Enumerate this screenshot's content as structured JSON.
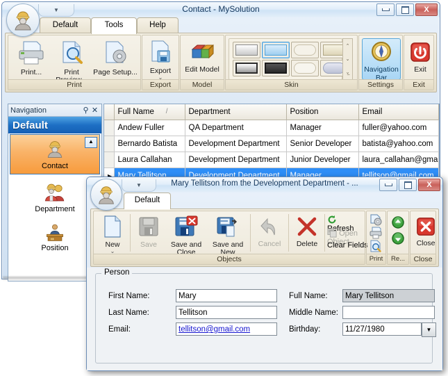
{
  "main_window": {
    "title": "Contact - MySolution",
    "app_icon": "person-hardhat-icon",
    "window_buttons": {
      "minimize": "minimize-icon",
      "maximize": "maximize-icon",
      "close": "X"
    },
    "quick_access_arrow": "▼",
    "tabs": [
      {
        "label": "Default",
        "active": false
      },
      {
        "label": "Tools",
        "active": true
      },
      {
        "label": "Help",
        "active": false
      }
    ],
    "ribbon": {
      "groups": [
        {
          "caption": "Print",
          "items": [
            {
              "label": "Print...",
              "icon": "printer-icon",
              "dropdown": false
            },
            {
              "label": "Print Preview...",
              "icon": "print-preview-icon",
              "dropdown": false
            },
            {
              "label": "Page Setup...",
              "icon": "page-setup-icon",
              "dropdown": false
            }
          ]
        },
        {
          "caption": "Export",
          "items": [
            {
              "label": "Export",
              "icon": "export-icon",
              "dropdown": true,
              "dropdown_glyph": "⌄"
            }
          ]
        },
        {
          "caption": "Model",
          "items": [
            {
              "label": "Edit Model",
              "icon": "edit-model-icon",
              "dropdown": false
            }
          ]
        },
        {
          "caption": "Skin",
          "gallery": [
            {
              "name": "skin-swatch-1",
              "fill": "linear-gradient(180deg,#ffffff,#c9c9c9)",
              "frame": "#8a8a8a",
              "selected": false
            },
            {
              "name": "skin-swatch-2",
              "fill": "linear-gradient(180deg,#dbeefc,#9ecef0)",
              "frame": "#4f9fd6",
              "selected": true
            },
            {
              "name": "skin-swatch-3",
              "fill": "#f5f2e9",
              "frame": "#c8c0aa",
              "rounded": true,
              "selected": false
            },
            {
              "name": "skin-swatch-4",
              "fill": "linear-gradient(180deg,#f7f3e2,#ddd5b8)",
              "frame": "#b0a685",
              "selected": false
            },
            {
              "name": "skin-swatch-5",
              "fill": "linear-gradient(180deg,#ffffff,#9a9a9a)",
              "frame": "#2c2c2c",
              "selected": false
            },
            {
              "name": "skin-swatch-6",
              "fill": "linear-gradient(180deg,#555555,#2a2a2a)",
              "frame": "#1b1b1b",
              "selected": false
            },
            {
              "name": "skin-swatch-7",
              "fill": "#f7f5ee",
              "frame": "#c8c0aa",
              "rounded": true,
              "selected": false
            },
            {
              "name": "skin-swatch-8",
              "fill": "linear-gradient(180deg,#e6e8f2,#bcc2d6)",
              "frame": "#9aa3bd",
              "rounded": true,
              "selected": false
            }
          ],
          "scroll_glyphs": [
            "⌃",
            "⌄",
            "⌄̲"
          ]
        },
        {
          "caption": "Settings",
          "items": [
            {
              "label": "Navigation Bar",
              "icon": "compass-icon",
              "selected": true
            }
          ]
        },
        {
          "caption": "Exit",
          "items": [
            {
              "label": "Exit",
              "icon": "power-icon"
            }
          ]
        }
      ]
    },
    "navigation_panel": {
      "header": "Navigation",
      "pin_icon": "pin-icon",
      "close_icon": "close-icon",
      "group_title": "Default",
      "collapse_glyph": "▲",
      "items": [
        {
          "label": "Contact",
          "icon": "person-hardhat-icon",
          "active": true
        },
        {
          "label": "Department",
          "icon": "people-group-icon",
          "active": false
        },
        {
          "label": "Position",
          "icon": "desk-person-icon",
          "active": false
        }
      ]
    },
    "grid": {
      "columns": [
        "Full Name",
        "Department",
        "Position",
        "Email"
      ],
      "sort_indicator": "/",
      "sort_column": "Full Name",
      "selected_row_index": 3,
      "row_indicator": "▶",
      "rows": [
        {
          "full_name": "Andew Fuller",
          "department": "QA Department",
          "position": "Manager",
          "email": "fuller@yahoo.com"
        },
        {
          "full_name": "Bernardo Batista",
          "department": "Development Department",
          "position": "Senior Developer",
          "email": "batista@yahoo.com"
        },
        {
          "full_name": "Laura Callahan",
          "department": "Development Department",
          "position": "Junior Developer",
          "email": "laura_callahan@gmail.com"
        },
        {
          "full_name": "Mary Tellitson",
          "department": "Development Department",
          "position": "Manager",
          "email": "tellitson@gmail.com"
        }
      ]
    }
  },
  "dialog": {
    "title": "Mary Tellitson from the Development Department - ...",
    "app_icon": "person-hardhat-icon",
    "quick_access_arrow": "▼",
    "window_buttons": {
      "minimize": "minimize-icon",
      "maximize": "maximize-icon",
      "close": "X"
    },
    "tabs": [
      {
        "label": "Default",
        "active": true
      }
    ],
    "ribbon": {
      "groups": [
        {
          "caption": "Objects",
          "items": [
            {
              "label": "New",
              "icon": "new-document-icon",
              "dropdown": true,
              "dropdown_glyph": "⌄",
              "disabled": false
            },
            {
              "label": "Save",
              "icon": "save-icon",
              "disabled": true
            },
            {
              "label": "Save and Close",
              "icon": "save-close-icon",
              "disabled": false
            },
            {
              "label": "Save and New",
              "icon": "save-new-icon",
              "dropdown": true,
              "dropdown_glyph": "⌄",
              "disabled": false
            },
            {
              "label": "Cancel",
              "icon": "undo-arrow-icon",
              "disabled": true
            },
            {
              "label": "Delete",
              "icon": "red-x-icon",
              "disabled": false
            },
            {
              "label": "Refresh",
              "icon": "refresh-icon",
              "disabled": false,
              "small": true
            },
            {
              "label": "Open Object",
              "icon": "open-object-icon",
              "disabled": true,
              "small": true
            },
            {
              "label": "Clear Fields",
              "icon": "",
              "disabled": false,
              "small": true
            }
          ]
        },
        {
          "caption": "Print",
          "items": [
            {
              "label": "",
              "icon": "print-setup-icon"
            },
            {
              "label": "",
              "icon": "printer-icon"
            },
            {
              "label": "",
              "icon": "print-preview-icon"
            }
          ]
        },
        {
          "caption": "Re...",
          "items": [
            {
              "label": "",
              "icon": "arrow-up-green-icon"
            },
            {
              "label": "",
              "icon": "arrow-down-green-icon"
            }
          ]
        },
        {
          "caption": "Close",
          "items": [
            {
              "label": "Close",
              "icon": "red-x-button-icon"
            }
          ]
        }
      ]
    },
    "form": {
      "legend": "Person",
      "fields": [
        {
          "label": "First Name:",
          "value": "Mary",
          "type": "text",
          "readonly": false
        },
        {
          "label": "Last Name:",
          "value": "Tellitson",
          "type": "text",
          "readonly": false
        },
        {
          "label": "Email:",
          "value": "tellitson@gmail.com",
          "type": "link",
          "readonly": false
        },
        {
          "label": "Full Name:",
          "value": "Mary Tellitson",
          "type": "text",
          "readonly": true
        },
        {
          "label": "Middle Name:",
          "value": "",
          "type": "text",
          "readonly": false
        },
        {
          "label": "Birthday:",
          "value": "11/27/1980",
          "type": "date",
          "readonly": false,
          "dropdown_glyph": "▼"
        }
      ]
    }
  },
  "colors": {
    "accent_selection": "#2e8ef7",
    "nav_active_orange": "#f79b3c",
    "nav_group_blue": "#1e6fc4",
    "ribbon_beige": "#ece6d6",
    "close_red": "#c9605a"
  }
}
